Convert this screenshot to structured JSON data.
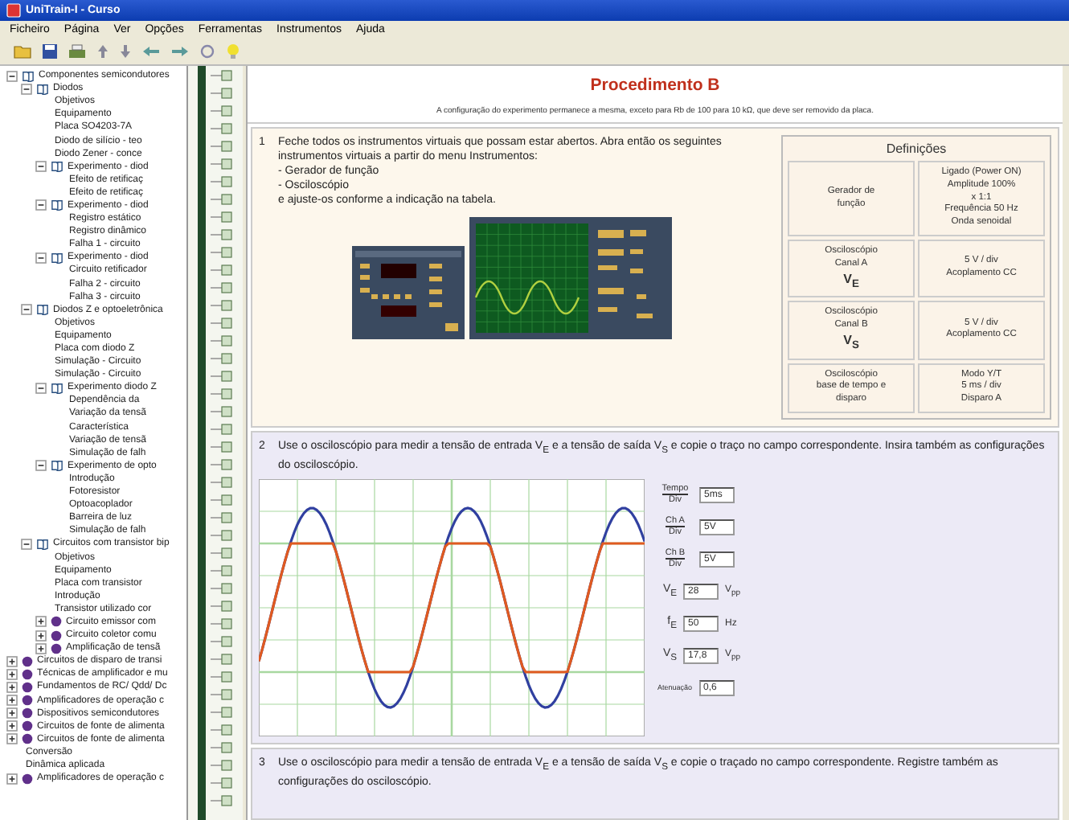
{
  "window": {
    "title": "UniTrain-I - Curso"
  },
  "menu": [
    "Ficheiro",
    "Página",
    "Ver",
    "Opções",
    "Ferramentas",
    "Instrumentos",
    "Ajuda"
  ],
  "tree": [
    {
      "label": "Componentes semicondutores",
      "kind": "chapter",
      "expanded": true,
      "children": [
        {
          "label": "Diodos",
          "kind": "chapter",
          "expanded": true,
          "children": [
            {
              "label": "Objetivos",
              "kind": "page"
            },
            {
              "label": "Equipamento",
              "kind": "page"
            },
            {
              "label": "Placa SO4203-7A",
              "kind": "page"
            },
            {
              "label": "Diodo de silício - teo",
              "kind": "page"
            },
            {
              "label": "Diodo Zener - conce",
              "kind": "page"
            },
            {
              "label": "Experimento - diod",
              "kind": "chapter",
              "expanded": true,
              "children": [
                {
                  "label": "Efeito de retificaç",
                  "kind": "page"
                },
                {
                  "label": "Efeito de retificaç",
                  "kind": "page"
                }
              ]
            },
            {
              "label": "Experimento - diod",
              "kind": "chapter",
              "expanded": true,
              "children": [
                {
                  "label": "Registro estático",
                  "kind": "page"
                },
                {
                  "label": "Registro dinâmico",
                  "kind": "page"
                },
                {
                  "label": "Falha 1 - circuito",
                  "kind": "page"
                }
              ]
            },
            {
              "label": "Experimento - diod",
              "kind": "chapter",
              "expanded": true,
              "children": [
                {
                  "label": "Circuito retificador",
                  "kind": "page"
                },
                {
                  "label": "Falha 2 - circuito",
                  "kind": "page"
                },
                {
                  "label": "Falha 3 - circuito",
                  "kind": "page"
                }
              ]
            }
          ]
        },
        {
          "label": "Diodos Z e optoeletrônica",
          "kind": "chapter",
          "expanded": true,
          "children": [
            {
              "label": "Objetivos",
              "kind": "page"
            },
            {
              "label": "Equipamento",
              "kind": "page"
            },
            {
              "label": "Placa com diodo Z",
              "kind": "page"
            },
            {
              "label": "Simulação - Circuito",
              "kind": "page"
            },
            {
              "label": "Simulação - Circuito",
              "kind": "page"
            },
            {
              "label": "Experimento diodo Z",
              "kind": "chapter",
              "expanded": true,
              "children": [
                {
                  "label": "Dependência da",
                  "kind": "page"
                },
                {
                  "label": "Variação da tensã",
                  "kind": "page"
                },
                {
                  "label": "Característica",
                  "kind": "page"
                },
                {
                  "label": "Variação de tensã",
                  "kind": "page"
                },
                {
                  "label": "Simulação de falh",
                  "kind": "page"
                }
              ]
            },
            {
              "label": "Experimento de opto",
              "kind": "chapter",
              "expanded": true,
              "children": [
                {
                  "label": "Introdução",
                  "kind": "page"
                },
                {
                  "label": "Fotoresistor",
                  "kind": "page"
                },
                {
                  "label": "Optoacoplador",
                  "kind": "page"
                },
                {
                  "label": "Barreira de luz",
                  "kind": "page"
                },
                {
                  "label": "Simulação de falh",
                  "kind": "page"
                }
              ]
            }
          ]
        },
        {
          "label": "Circuitos com transistor bip",
          "kind": "chapter",
          "expanded": true,
          "children": [
            {
              "label": "Objetivos",
              "kind": "page"
            },
            {
              "label": "Equipamento",
              "kind": "page"
            },
            {
              "label": "Placa com transistor",
              "kind": "page"
            },
            {
              "label": "Introdução",
              "kind": "page"
            },
            {
              "label": "Transistor utilizado cor",
              "kind": "page"
            },
            {
              "label": "Circuito emissor com",
              "kind": "module",
              "expanded": false
            },
            {
              "label": "Circuito coletor comu",
              "kind": "module",
              "expanded": false
            },
            {
              "label": "Amplificação de tensã",
              "kind": "module",
              "expanded": false
            }
          ]
        }
      ]
    },
    {
      "label": "Circuitos de disparo de transi",
      "kind": "module",
      "expanded": false
    },
    {
      "label": "Técnicas de amplificador e mu",
      "kind": "module",
      "expanded": false
    },
    {
      "label": "Fundamentos de RC/ Qdd/ Dc",
      "kind": "module",
      "expanded": false
    },
    {
      "label": "Amplificadores de operação c",
      "kind": "module",
      "expanded": false
    },
    {
      "label": "Dispositivos semicondutores",
      "kind": "module",
      "expanded": false
    },
    {
      "label": "Circuitos de fonte de alimenta",
      "kind": "module",
      "expanded": false
    },
    {
      "label": "Circuitos de fonte de alimenta",
      "kind": "module",
      "expanded": false
    },
    {
      "label": "Conversão",
      "kind": "page"
    },
    {
      "label": "Dinâmica aplicada",
      "kind": "page"
    },
    {
      "label": "Amplificadores de operação c",
      "kind": "module",
      "expanded": false
    }
  ],
  "content": {
    "title": "Procedimento B",
    "subtitle": "A configuração do experimento permanece a mesma, exceto para Rb de 100 para 10 kΩ, que deve ser removido da placa.",
    "step1": {
      "number": "1",
      "text": "Feche todos os instrumentos virtuais que possam estar abertos. Abra então os seguintes instrumentos virtuais a partir do menu Instrumentos:",
      "items": [
        "- Gerador de função",
        "- Osciloscópio"
      ],
      "closing": "e ajuste-os conforme a indicação na tabela."
    },
    "definitions": {
      "title": "Definições",
      "rows": [
        {
          "name": [
            "Gerador de",
            "função"
          ],
          "value": [
            "Ligado (Power ON)",
            "Amplitude 100%",
            "x 1:1",
            "Frequência 50 Hz",
            "Onda senoidal"
          ]
        },
        {
          "name": [
            "Osciloscópio",
            "Canal A",
            "V$_{E}$"
          ],
          "value": [
            "5 V / div",
            "Acoplamento CC"
          ]
        },
        {
          "name": [
            "Osciloscópio",
            "Canal B",
            "V$_{S}$"
          ],
          "value": [
            "5 V / div",
            "Acoplamento CC"
          ]
        },
        {
          "name": [
            "Osciloscópio",
            "base de tempo e",
            "disparo"
          ],
          "value": [
            "Modo Y/T",
            "5 ms / div",
            "Disparo A"
          ]
        }
      ]
    },
    "step2": {
      "number": "2",
      "text": "Use o osciloscópio para medir a tensão de entrada V$_{E}$ e a tensão de saída V$_{S}$ e copie o traço no campo correspondente. Insira também as configurações do osciloscópio.",
      "fields": [
        {
          "kind": "ratio",
          "label": "Tempo",
          "denom": "Div",
          "value": "5ms"
        },
        {
          "kind": "ratio",
          "label": "Ch A",
          "denom": "Div",
          "value": "5V"
        },
        {
          "kind": "ratio",
          "label": "Ch B",
          "denom": "Div",
          "value": "5V"
        },
        {
          "kind": "measure",
          "label": "V$_{E}$",
          "value": "28",
          "unit": "V$_{pp}$"
        },
        {
          "kind": "measure",
          "label": "f$_{E}$",
          "value": "50",
          "unit": "Hz"
        },
        {
          "kind": "measure",
          "label": "V$_{S}$",
          "value": "17,8",
          "unit": "V$_{pp}$"
        },
        {
          "kind": "small",
          "label": "Atenuação",
          "value": "0,6"
        }
      ]
    },
    "step3": {
      "number": "3",
      "text": "Use o osciloscópio para medir a tensão de entrada V$_{E}$ e a tensão de saída V$_{S}$ e copie o traçado no campo correspondente. Registre também as configurações do osciloscópio."
    }
  }
}
